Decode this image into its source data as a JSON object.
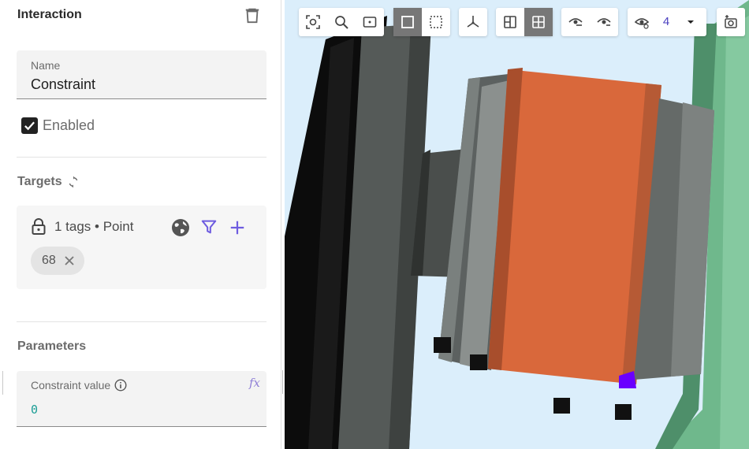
{
  "panel": {
    "title": "Interaction",
    "name_field": {
      "label": "Name",
      "value": "Constraint"
    },
    "enabled": {
      "label": "Enabled",
      "checked": true
    },
    "targets": {
      "title": "Targets",
      "summary": "1 tags • Point",
      "chips": [
        "68"
      ]
    },
    "parameters": {
      "title": "Parameters",
      "constraint_field": {
        "label": "Constraint value",
        "value": "0",
        "fx": "fx"
      }
    }
  },
  "viewport": {
    "toolbar": {
      "visible_count": "4"
    }
  },
  "colors": {
    "accent": "#6e5ce0",
    "orange_part": "#d9683b",
    "selected_marker": "#6a00ff",
    "viewport_bg": "#dbeefb",
    "green_frame": "#6fb88c"
  }
}
